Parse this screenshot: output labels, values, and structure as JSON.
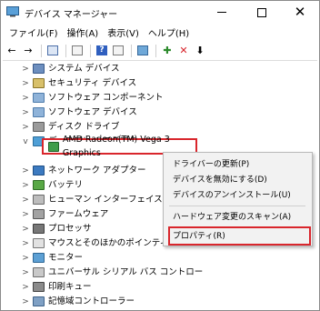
{
  "window": {
    "title": "デバイス マネージャー",
    "controls": {
      "minimize": "—",
      "maximize": "☐",
      "close": "✕"
    }
  },
  "menubar": [
    "ファイル(F)",
    "操作(A)",
    "表示(V)",
    "ヘルプ(H)"
  ],
  "toolbar": {
    "back": "←",
    "forward": "→",
    "scan_label": "✚",
    "uninstall": "✕",
    "update": "⬇"
  },
  "tree": [
    {
      "label": "システム デバイス",
      "icon": "system-devices-icon",
      "expanded": false
    },
    {
      "label": "セキュリティ デバイス",
      "icon": "security-devices-icon",
      "expanded": false
    },
    {
      "label": "ソフトウェア コンポーネント",
      "icon": "software-components-icon",
      "expanded": false
    },
    {
      "label": "ソフトウェア デバイス",
      "icon": "software-devices-icon",
      "expanded": false
    },
    {
      "label": "ディスク ドライブ",
      "icon": "disk-drives-icon",
      "expanded": false
    },
    {
      "label": "ディスプレイ アダプター",
      "icon": "display-adapters-icon",
      "expanded": true
    },
    {
      "label": "AMD Radeon(TM) Vega 3 Graphics",
      "icon": "gpu-icon",
      "child": true,
      "selected": true
    },
    {
      "label": "ネットワーク アダプター",
      "icon": "network-adapters-icon",
      "expanded": false
    },
    {
      "label": "バッテリ",
      "icon": "battery-icon",
      "expanded": false
    },
    {
      "label": "ヒューマン インターフェイス デバイ",
      "icon": "hid-icon",
      "expanded": false
    },
    {
      "label": "ファームウェア",
      "icon": "firmware-icon",
      "expanded": false
    },
    {
      "label": "プロセッサ",
      "icon": "processor-icon",
      "expanded": false
    },
    {
      "label": "マウスとそのほかのポインティン",
      "icon": "mouse-icon",
      "expanded": false
    },
    {
      "label": "モニター",
      "icon": "monitor-icon",
      "expanded": false
    },
    {
      "label": "ユニバーサル シリアル バス コントロー",
      "icon": "usb-icon",
      "expanded": false
    },
    {
      "label": "印刷キュー",
      "icon": "print-queue-icon",
      "expanded": false
    },
    {
      "label": "記憶域コントローラー",
      "icon": "storage-controller-icon",
      "expanded": false
    }
  ],
  "context_menu": {
    "items": [
      "ドライバーの更新(P)",
      "デバイスを無効にする(D)",
      "デバイスのアンインストール(U)",
      "ハードウェア変更のスキャン(A)",
      "プロパティ(R)"
    ]
  },
  "colors": {
    "highlight_box": "#d9262c"
  }
}
